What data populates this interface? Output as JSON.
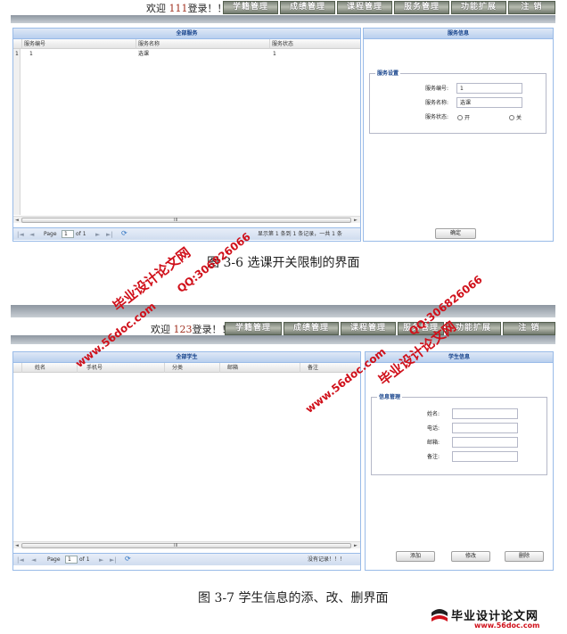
{
  "top_screenshot": {
    "welcome_prefix": "欢迎",
    "welcome_user": "111",
    "welcome_suffix": "登录！！",
    "nav_tabs": [
      "学籍管理",
      "成绩管理",
      "课程管理",
      "服务管理",
      "功能扩展",
      "注  销"
    ],
    "left_panel": {
      "title": "全部服务",
      "columns": [
        "服务编号",
        "服务名称",
        "服务状态"
      ],
      "rows": [
        {
          "index": "1",
          "id": "1",
          "name": "选课",
          "status": "1"
        }
      ],
      "scroll_marker": "III",
      "pager": {
        "page_label": "Page",
        "page_value": "1",
        "of_label": "of 1",
        "summary": "显示第 1 条到 1 条记录，一共 1 条"
      }
    },
    "right_panel": {
      "title": "服务信息",
      "fieldset_legend": "服务设置",
      "fields": [
        {
          "label": "服务编号:",
          "value": "1"
        },
        {
          "label": "服务名称:",
          "value": "选课"
        }
      ],
      "status_label": "服务状态:",
      "radio_on": "开",
      "radio_off": "关",
      "confirm_button": "确定"
    }
  },
  "caption_top": "图 3-6  选课开关限制的界面",
  "bottom_screenshot": {
    "welcome_prefix": "欢迎",
    "welcome_user": "123",
    "welcome_suffix": "登录！！",
    "nav_tabs": [
      "学籍管理",
      "成绩管理",
      "课程管理",
      "服务管理",
      "功能扩展",
      "注  销"
    ],
    "left_panel": {
      "title": "全部学生",
      "columns": [
        "姓名",
        "手机号",
        "分类",
        "邮箱",
        "备注"
      ],
      "scroll_marker": "III",
      "pager": {
        "page_label": "Page",
        "page_value": "1",
        "of_label": "of 1",
        "summary": "没有记录！！！"
      }
    },
    "right_panel": {
      "title": "学生信息",
      "fieldset_legend": "信息管理",
      "fields": [
        {
          "label": "姓名:",
          "value": ""
        },
        {
          "label": "电话:",
          "value": ""
        },
        {
          "label": "邮箱:",
          "value": ""
        },
        {
          "label": "备注:",
          "value": ""
        }
      ],
      "buttons": [
        "添加",
        "修改",
        "删除"
      ]
    }
  },
  "caption_bottom": "图 3-7  学生信息的添、改、删界面",
  "watermarks": {
    "site_name": "毕业设计论文网",
    "site_url": "www.56doc.com",
    "qq": "QQ:306826066"
  },
  "logo": {
    "title": "毕业设计论文网",
    "url": "www.56doc.com"
  },
  "colors": {
    "panel_border": "#99bbe8",
    "panel_title": "#15428b",
    "watermark_red": "#d0101a",
    "welcome_number": "#a03020"
  }
}
